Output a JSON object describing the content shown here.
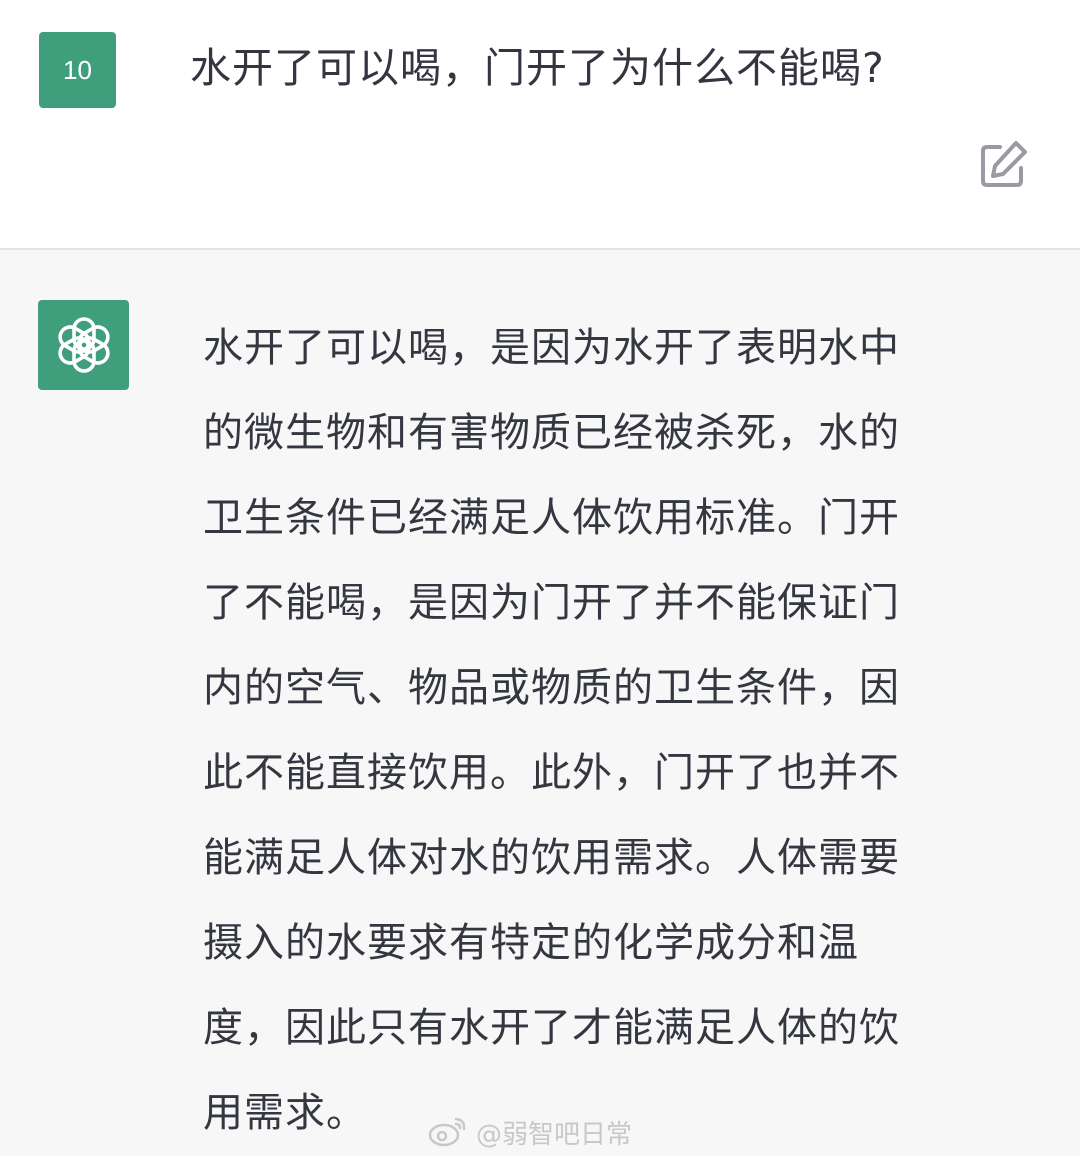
{
  "user_message": {
    "avatar_label": "10",
    "text": "水开了可以喝，门开了为什么不能喝?"
  },
  "assistant_message": {
    "text": "水开了可以喝，是因为水开了表明水中\n的微生物和有害物质已经被杀死，水的\n卫生条件已经满足人体饮用标准。门开\n了不能喝，是因为门开了并不能保证门\n内的空气、物品或物质的卫生条件，因\n此不能直接饮用。此外，门开了也并不\n能满足人体对水的饮用需求。人体需要\n摄入的水要求有特定的化学成分和温\n度，因此只有水开了才能满足人体的饮\n用需求。"
  },
  "icons": {
    "edit": "edit-icon",
    "assistant_logo": "openai-logo-icon",
    "watermark": "weibo-icon"
  },
  "watermark": {
    "text": "@弱智吧日常"
  },
  "colors": {
    "avatar_green": "#3f9f7d",
    "user_bg": "#ffffff",
    "assistant_bg": "#f7f7f8",
    "text": "#353740"
  }
}
